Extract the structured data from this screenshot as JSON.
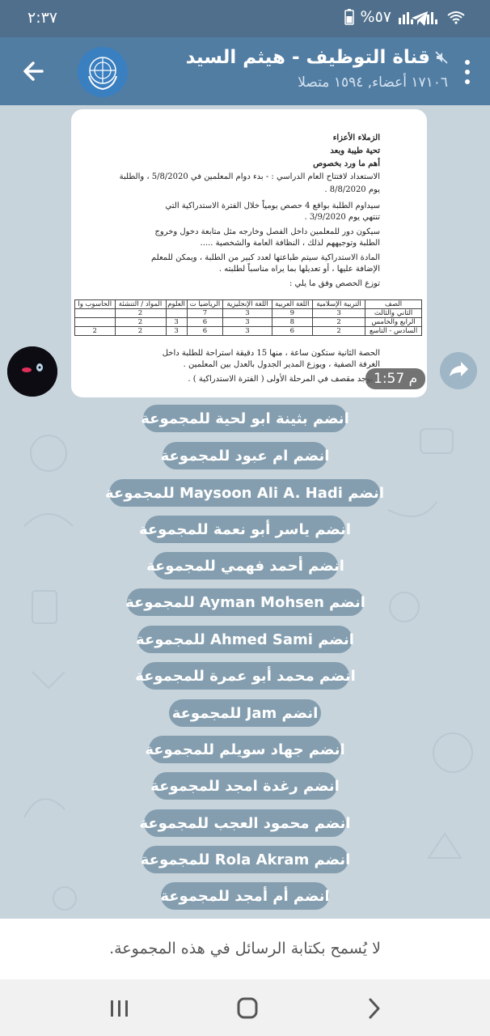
{
  "status_bar": {
    "time": "٢:٣٧",
    "battery": "%٥٧",
    "icons": [
      "telegram-icon",
      "wifi-icon",
      "signal-icon",
      "signal-icon",
      "battery-icon"
    ]
  },
  "header": {
    "title": "قناة التوظيف - هيثم السيد",
    "subtitle": "١٧١٠٦ أعضاء, ١٥٩٤ متصلا",
    "muted_icon": "mute-icon"
  },
  "message": {
    "duration": "1:57 م",
    "document": {
      "lines": [
        "الزملاء الأعزاء",
        "تحية طيبة وبعد",
        "أهم ما ورد بخصوص",
        "الاستعداد لافتتاح العام الدراسي : - بدء دوام المعلمين في 5/8/2020 ، والطلبة",
        "يوم 8/8/2020 .",
        "سيداوم الطلبة بواقع 4 حصص يومياً خلال الفترة الاستدراكية التي",
        "تنتهي يوم 3/9/2020 .",
        "سيكون دور للمعلمين داخل الفصل وخارجه مثل متابعة دخول وخروج",
        "الطلبة وتوجيههم لذلك ، النظافة العامة والشخصية .....",
        "المادة الاستدراكية سيتم طباعتها لعدد كبير من الطلبة ، ويمكن للمعلم",
        "الإضافة عليها ، أو تعديلها بما يراه مناسباً لطلبته .",
        "توزع الحصص وفق ما يلي :"
      ],
      "table_header": [
        "الصف",
        "التربية الإسلامية",
        "اللغة العربية",
        "اللغة الإنجليزية",
        "الرياضيا ت",
        "العلوم",
        "المواد / التنشئة",
        "الحاسوب وا"
      ],
      "table_rows": [
        [
          "الثاني والثالث",
          "3",
          "9",
          "3",
          "7",
          "",
          "2",
          ""
        ],
        [
          "الرابع والخامس",
          "2",
          "8",
          "3",
          "6",
          "3",
          "2",
          ""
        ],
        [
          "السادس - التاسع",
          "2",
          "6",
          "3",
          "6",
          "3",
          "2",
          "2"
        ]
      ],
      "footer_lines": [
        "الحصة الثانية ستكون ساعة ، منها 15 دقيقة استراحة للطلبة داخل",
        "الغرفة الصفية ، ويوزع المدير الجدول بالعدل بين المعلمين .",
        "لا يوجد مقصف في المرحلة الأولى ( الفترة الاستدراكية ) ."
      ]
    }
  },
  "join_buttons": [
    "انضم بثينة ابو لحية للمجموعة",
    "انضم ام عبود للمجموعة",
    "انضم Maysoon Ali A. Hadi للمجموعة",
    "انضم ياسر أبو نعمة للمجموعة",
    "انضم أحمد فهمي للمجموعة",
    "انضم Ayman Mohsen للمجموعة",
    "انضم Ahmed Sami للمجموعة",
    "انضم محمد أبو عمرة للمجموعة",
    "انضم Jam للمجموعة",
    "انضم جهاد سويلم للمجموعة",
    "انضم رغدة امجد للمجموعة",
    "انضم محمود العجب للمجموعة",
    "انضم Rola Akram للمجموعة",
    "انضم أم أمجد للمجموعة"
  ],
  "composer": {
    "notice": "لا يُسمح بكتابة الرسائل في هذه المجموعة."
  },
  "navbar": {
    "icons": [
      "recent-apps-icon",
      "home-icon",
      "back-nav-icon"
    ]
  },
  "colors": {
    "header": "#527da3",
    "status_bar": "#4f6f8c",
    "chat_bg": "#c7d4dc",
    "service_pill": "#7f9bb0"
  }
}
